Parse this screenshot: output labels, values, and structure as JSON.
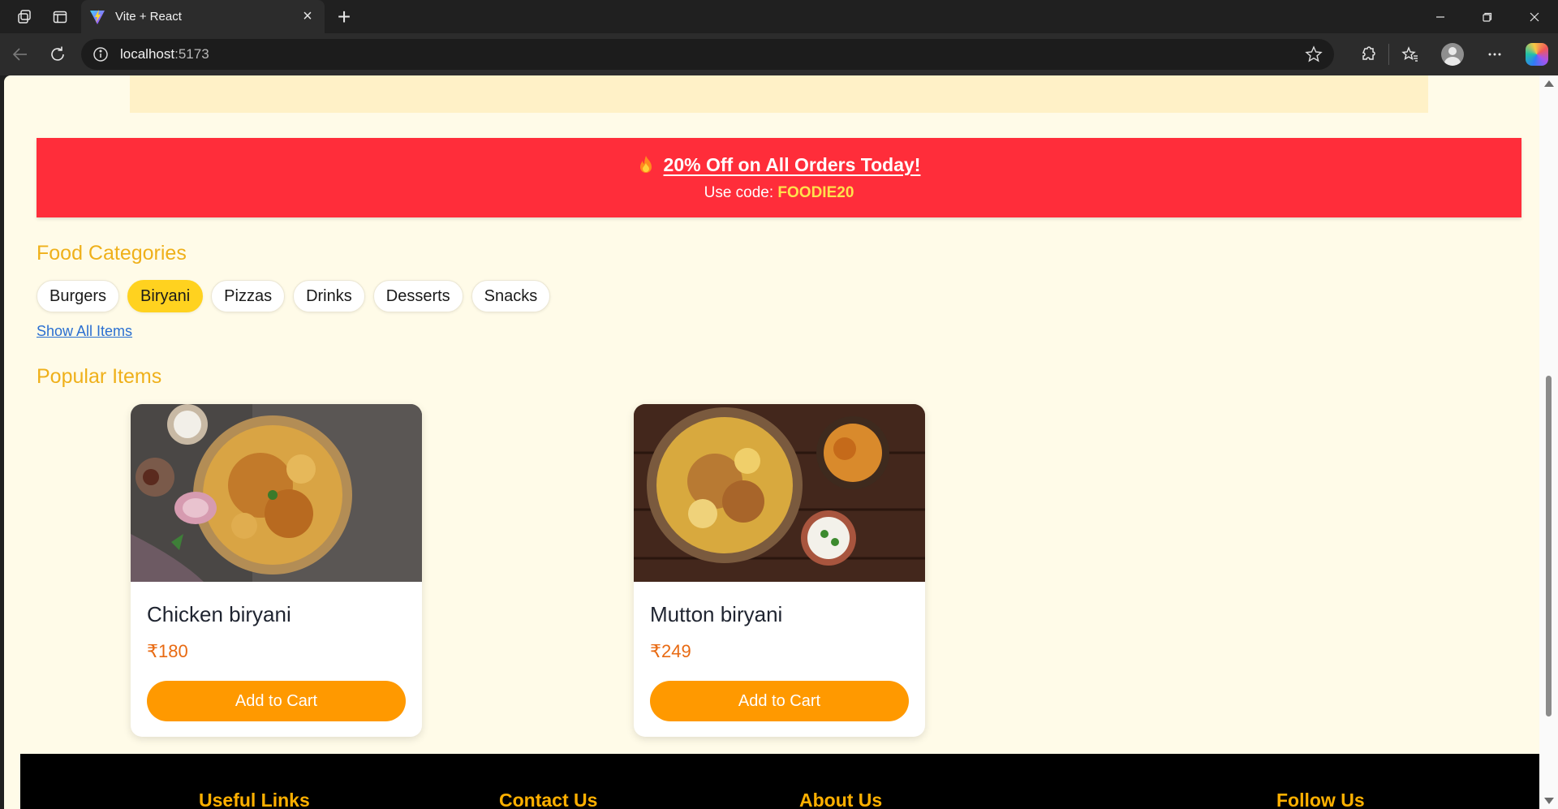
{
  "browser": {
    "tab_title": "Vite + React",
    "url_host": "localhost",
    "url_port": ":5173"
  },
  "promo": {
    "title": "20% Off on All Orders Today!",
    "code_prefix": "Use code: ",
    "code": "FOODIE20"
  },
  "categories": {
    "heading": "Food Categories",
    "items": [
      "Burgers",
      "Biryani",
      "Pizzas",
      "Drinks",
      "Desserts",
      "Snacks"
    ],
    "active": "Biryani",
    "show_all": "Show All Items"
  },
  "popular": {
    "heading": "Popular Items",
    "items": [
      {
        "name": "Chicken biryani",
        "price": "₹180",
        "button": "Add to Cart"
      },
      {
        "name": "Mutton biryani",
        "price": "₹249",
        "button": "Add to Cart"
      }
    ]
  },
  "footer": {
    "headings": [
      "Useful Links",
      "Contact Us",
      "About Us",
      "Follow Us"
    ]
  },
  "colors": {
    "page_bg": "#fffbe8",
    "promo_bg": "#ff2d3a",
    "accent_yellow": "#ffd21f",
    "heading_gold": "#efb01a",
    "button_orange": "#ff9900",
    "price_orange": "#e86a12",
    "footer_bg": "#000000",
    "footer_heading": "#ffb000"
  }
}
